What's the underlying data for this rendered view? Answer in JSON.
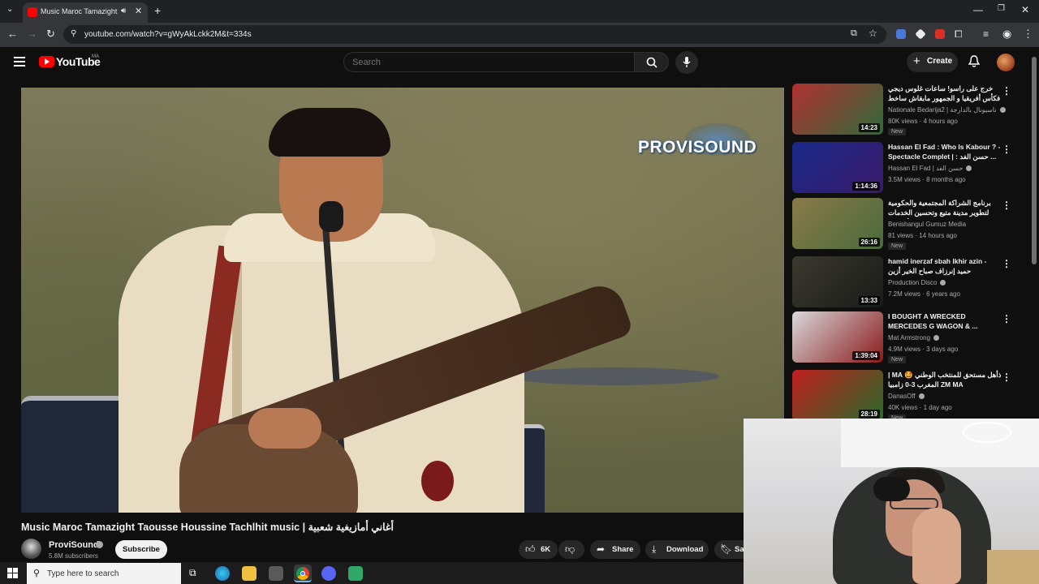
{
  "browser": {
    "tab_title": "Music Maroc Tamazight Taousse Houssine Tachlhit music | أغاني أمازيغية شعبية",
    "tab_dropdown_icon": "chevron-down-icon",
    "new_tab_icon": "plus-icon",
    "url": "youtube.com/watch?v=gWyAkLckk2M&t=334s"
  },
  "youtube": {
    "logo_text": "YouTube",
    "country_code": "MA",
    "search_placeholder": "Search",
    "create_label": "Create"
  },
  "video": {
    "title": "Music Maroc Tamazight Taousse Houssine Tachlhit music | أغاني أمازيغية شعبية",
    "watermark": "PROVISOUND",
    "channel_name": "ProviSound",
    "subscribers": "5.8M subscribers",
    "subscribe_label": "Subscribe",
    "like_count": "6K",
    "share_label": "Share",
    "download_label": "Download",
    "save_label": "Sa"
  },
  "recommendations": [
    {
      "title": "خرج على راسو! ساعات غلوس ديجي فكأس أفريقيا و الجمهور مابقاش ساخط على ...",
      "channel": "Nationale Bedarija2 | ناسيونال بالدارجة",
      "verified": true,
      "meta": "80K views · 4 hours ago",
      "badge": "New",
      "duration": "14:23",
      "thumb_colors": [
        "#b03030",
        "#2f6a3a"
      ]
    },
    {
      "title": "Hassan El Fad : Who Is Kabour ? - Spectacle Complet | : حسن الفد ...",
      "channel": "Hassan El Fad | حسن الفد",
      "verified": true,
      "meta": "3.5M views · 8 months ago",
      "badge": "",
      "duration": "1:14:36",
      "thumb_colors": [
        "#1a2a8a",
        "#3a1a6a"
      ]
    },
    {
      "title": "برنامج الشراكة المجتمعية والحكومية لتطوير مدينة متيع وتحسين الخدمات الأساسية",
      "channel": "Benishangul Gumuz Media",
      "verified": false,
      "meta": "81 views · 14 hours ago",
      "badge": "New",
      "duration": "26:16",
      "thumb_colors": [
        "#8a7a4a",
        "#4a6a3a"
      ]
    },
    {
      "title": "hamid inerzaf sbah lkhir azin - حميد إنرزاف صباح الخير أزين",
      "channel": "Production Disco",
      "verified": true,
      "meta": "7.2M views · 6 years ago",
      "badge": "",
      "duration": "13:33",
      "thumb_colors": [
        "#3a3a30",
        "#1a1a18"
      ]
    },
    {
      "title": "I BOUGHT A WRECKED MERCEDES G WAGON & ...",
      "channel": "Mat Armstrong",
      "verified": true,
      "meta": "4.9M views · 3 days ago",
      "badge": "New",
      "duration": "1:39:04",
      "thumb_colors": [
        "#d8d8dc",
        "#8a1a1a"
      ]
    },
    {
      "title": "| MA 🤩 ذأهل مستحق للمنتخب الوطني المغرب 3-0 زامبيا ZM MA",
      "channel": "DanasOff",
      "verified": true,
      "meta": "40K views · 1 day ago",
      "badge": "New",
      "duration": "28:19",
      "thumb_colors": [
        "#c02020",
        "#2a6a2a"
      ]
    }
  ],
  "taskbar": {
    "search_placeholder": "Type here to search"
  },
  "colors": {
    "background": "#0f0f0f",
    "youtube_red": "#ff0000",
    "chrome_frame": "#202124"
  }
}
